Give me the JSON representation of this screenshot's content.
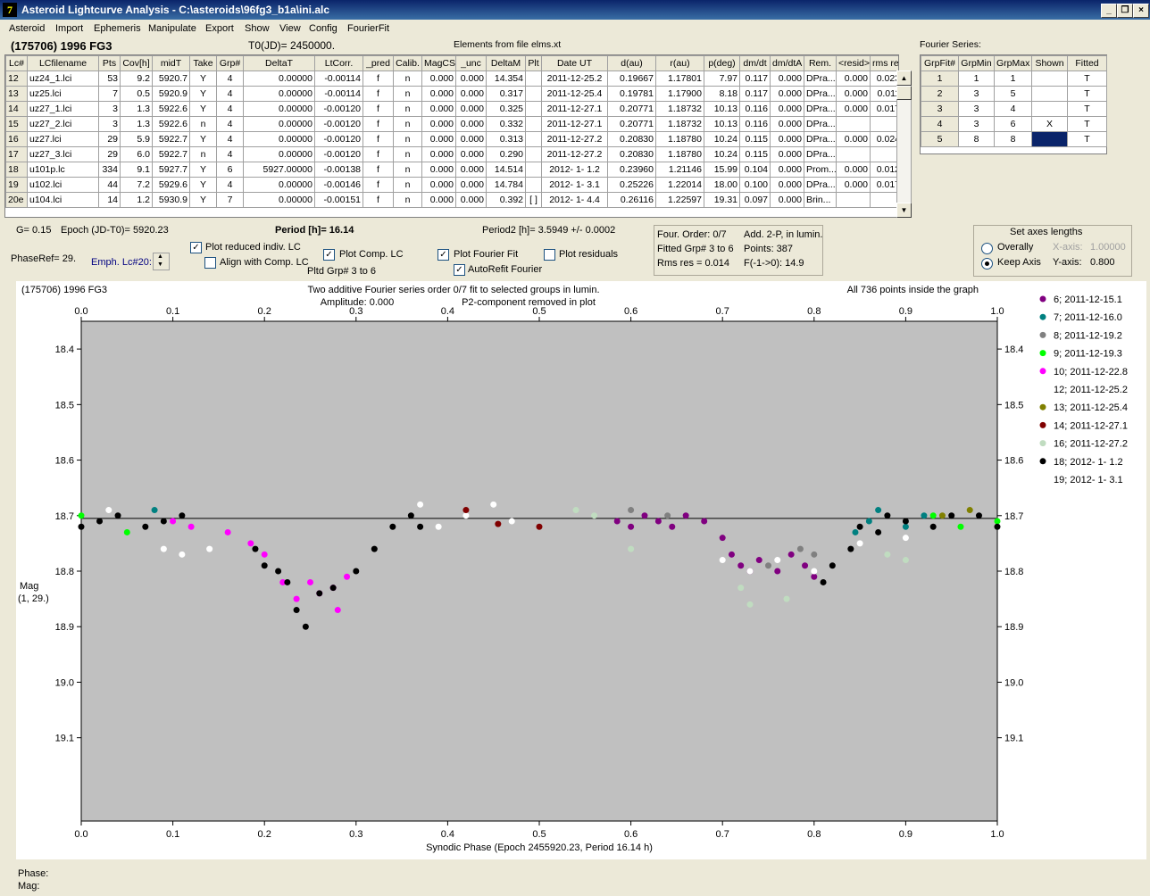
{
  "window": {
    "title": "Asteroid Lightcurve Analysis - C:\\asteroids\\96fg3_b1a\\ini.alc",
    "icon": "app-icon",
    "min": "_",
    "restore": "❐",
    "close": "×"
  },
  "menu": [
    "Asteroid",
    "Import",
    "Ephemeris",
    "Manipulate",
    "Export",
    "Show",
    "View",
    "Config",
    "FourierFit"
  ],
  "header": {
    "asteroid": "(175706) 1996 FG3",
    "t0": "T0(JD)= 2450000.",
    "elements": "Elements from file elms.xt",
    "fourier_series": "Fourier Series:"
  },
  "lc_table": {
    "columns": [
      "Lc#",
      "LCfilename",
      "Pts",
      "Cov[h]",
      "midT",
      "Take",
      "Grp#",
      "DeltaT",
      "LtCorr.",
      "_pred",
      "Calib.",
      "MagCS",
      "_unc",
      "DeltaM",
      "Plt",
      "Date UT",
      "d(au)",
      "r(au)",
      "p(deg)",
      "dm/dt",
      "dm/dtA",
      "Rem.",
      "<resid>",
      "rms res"
    ],
    "rows": [
      [
        "12",
        "uz24_1.lci",
        "53",
        "9.2",
        "5920.7",
        "Y",
        "4",
        "0.00000",
        "-0.00114",
        "f",
        "n",
        "0.000",
        "0.000",
        "14.354",
        "",
        "2011-12-25.2",
        "0.19667",
        "1.17801",
        "7.97",
        "0.117",
        "0.000",
        "DPra...",
        "0.000",
        "0.023"
      ],
      [
        "13",
        "uz25.lci",
        "7",
        "0.5",
        "5920.9",
        "Y",
        "4",
        "0.00000",
        "-0.00114",
        "f",
        "n",
        "0.000",
        "0.000",
        "0.317",
        "",
        "2011-12-25.4",
        "0.19781",
        "1.17900",
        "8.18",
        "0.117",
        "0.000",
        "DPra...",
        "0.000",
        "0.011"
      ],
      [
        "14",
        "uz27_1.lci",
        "3",
        "1.3",
        "5922.6",
        "Y",
        "4",
        "0.00000",
        "-0.00120",
        "f",
        "n",
        "0.000",
        "0.000",
        "0.325",
        "",
        "2011-12-27.1",
        "0.20771",
        "1.18732",
        "10.13",
        "0.116",
        "0.000",
        "DPra...",
        "0.000",
        "0.017"
      ],
      [
        "15",
        "uz27_2.lci",
        "3",
        "1.3",
        "5922.6",
        "n",
        "4",
        "0.00000",
        "-0.00120",
        "f",
        "n",
        "0.000",
        "0.000",
        "0.332",
        "",
        "2011-12-27.1",
        "0.20771",
        "1.18732",
        "10.13",
        "0.116",
        "0.000",
        "DPra...",
        "",
        ""
      ],
      [
        "16",
        "uz27.lci",
        "29",
        "5.9",
        "5922.7",
        "Y",
        "4",
        "0.00000",
        "-0.00120",
        "f",
        "n",
        "0.000",
        "0.000",
        "0.313",
        "",
        "2011-12-27.2",
        "0.20830",
        "1.18780",
        "10.24",
        "0.115",
        "0.000",
        "DPra...",
        "0.000",
        "0.024"
      ],
      [
        "17",
        "uz27_3.lci",
        "29",
        "6.0",
        "5922.7",
        "n",
        "4",
        "0.00000",
        "-0.00120",
        "f",
        "n",
        "0.000",
        "0.000",
        "0.290",
        "",
        "2011-12-27.2",
        "0.20830",
        "1.18780",
        "10.24",
        "0.115",
        "0.000",
        "DPra...",
        "",
        ""
      ],
      [
        "18",
        "u101p.lc",
        "334",
        "9.1",
        "5927.7",
        "Y",
        "6",
        "5927.00000",
        "-0.00138",
        "f",
        "n",
        "0.000",
        "0.000",
        "14.514",
        "",
        "2012- 1- 1.2",
        "0.23960",
        "1.21146",
        "15.99",
        "0.104",
        "0.000",
        "Prom...",
        "0.000",
        "0.012"
      ],
      [
        "19",
        "u102.lci",
        "44",
        "7.2",
        "5929.6",
        "Y",
        "4",
        "0.00000",
        "-0.00146",
        "f",
        "n",
        "0.000",
        "0.000",
        "14.784",
        "",
        "2012- 1- 3.1",
        "0.25226",
        "1.22014",
        "18.00",
        "0.100",
        "0.000",
        "DPra...",
        "0.000",
        "0.017"
      ],
      [
        "20e",
        "u104.lci",
        "14",
        "1.2",
        "5930.9",
        "Y",
        "7",
        "0.00000",
        "-0.00151",
        "f",
        "n",
        "0.000",
        "0.000",
        "0.392",
        "[ ]",
        "2012- 1- 4.4",
        "0.26116",
        "1.22597",
        "19.31",
        "0.097",
        "0.000",
        "Brin...",
        "",
        ""
      ]
    ]
  },
  "fourier_table": {
    "columns": [
      "GrpFit#",
      "GrpMin",
      "GrpMax",
      "Shown",
      "Fitted"
    ],
    "rows": [
      [
        "1",
        "1",
        "1",
        "",
        "T"
      ],
      [
        "2",
        "3",
        "5",
        "",
        "T"
      ],
      [
        "3",
        "3",
        "4",
        "",
        "T"
      ],
      [
        "4",
        "3",
        "6",
        "X",
        "T"
      ],
      [
        "5",
        "8",
        "8",
        "",
        "T"
      ]
    ]
  },
  "params": {
    "g": "G= 0.15",
    "epoch": "Epoch (JD-T0)= 5920.23",
    "period": "Period [h]= 16.14",
    "period2": "Period2 [h]= 3.5949 +/- 0.0002",
    "phase_ref": "PhaseRef= 29.",
    "emph": "Emph. Lc#20:",
    "pltd_grp": "Pltd Grp#  3  to   6"
  },
  "checkboxes": {
    "plot_reduced": "Plot reduced indiv. LC",
    "align": "Align with Comp. LC",
    "plot_comp": "Plot Comp. LC",
    "plot_fourier": "Plot Fourier Fit",
    "autorefit": "AutoRefit Fourier",
    "plot_residuals": "Plot residuals"
  },
  "fit_info": {
    "order": "Four. Order:  0/7",
    "add": "Add. 2-P, in lumin.",
    "fitted": "Fitted Grp# 3 to 6",
    "points": "Points: 387",
    "rms": "Rms res     = 0.014",
    "f": "F(-1->0):  14.9"
  },
  "axes_box": {
    "title": "Set axes lengths",
    "overally": "Overally",
    "keep": "Keep Axis",
    "xaxis_label": "X-axis:",
    "xaxis_val": "1.00000",
    "yaxis_label": "Y-axis:",
    "yaxis_val": "0.800"
  },
  "plot": {
    "asteroid": "(175706) 1996 FG3",
    "title1": "Two additive Fourier series order 0/7 fit to selected groups in lumin.",
    "title2": "Amplitude: 0.000",
    "title3": "P2-component removed in plot",
    "inside": "All 736 points inside the graph",
    "ylabel1": "Mag",
    "ylabel2": "(1, 29.)",
    "xlabel": "Synodic Phase (Epoch 2455920.23, Period 16.14 h)",
    "legend": [
      {
        "label": "6; 2011-12-15.1",
        "color": "#800080"
      },
      {
        "label": "7; 2011-12-16.0",
        "color": "#008080"
      },
      {
        "label": "8; 2011-12-19.2",
        "color": "#808080"
      },
      {
        "label": "9; 2011-12-19.3",
        "color": "#00ff00"
      },
      {
        "label": "10; 2011-12-22.8",
        "color": "#ff00ff"
      },
      {
        "label": "12; 2011-12-25.2",
        "color": "#ffffff"
      },
      {
        "label": "13; 2011-12-25.4",
        "color": "#808000"
      },
      {
        "label": "14; 2011-12-27.1",
        "color": "#800000"
      },
      {
        "label": "16; 2011-12-27.2",
        "color": "#c0dcc0"
      },
      {
        "label": "18; 2012- 1- 1.2",
        "color": "#000000"
      },
      {
        "label": "19; 2012- 1- 3.1",
        "color": "#ffffff"
      }
    ]
  },
  "chart_data": {
    "type": "scatter",
    "xlabel": "Synodic Phase (Epoch 2455920.23, Period 16.14 h)",
    "ylabel": "Mag",
    "xlim": [
      0.0,
      1.0
    ],
    "ylim": [
      19.25,
      18.35
    ],
    "xticks": [
      "0.0",
      "0.1",
      "0.2",
      "0.3",
      "0.4",
      "0.5",
      "0.6",
      "0.7",
      "0.8",
      "0.9",
      "1.0"
    ],
    "yticks": [
      "18.4",
      "18.5",
      "18.6",
      "18.7",
      "18.8",
      "18.9",
      "19.0",
      "19.1"
    ],
    "reference_line": 18.705,
    "series": [
      {
        "name": "6; 2011-12-15.1",
        "color": "#800080",
        "points": [
          [
            0.585,
            18.71
          ],
          [
            0.6,
            18.72
          ],
          [
            0.615,
            18.7
          ],
          [
            0.63,
            18.71
          ],
          [
            0.645,
            18.72
          ],
          [
            0.66,
            18.7
          ],
          [
            0.68,
            18.71
          ],
          [
            0.7,
            18.74
          ],
          [
            0.71,
            18.77
          ],
          [
            0.72,
            18.79
          ],
          [
            0.73,
            18.8
          ],
          [
            0.74,
            18.78
          ],
          [
            0.76,
            18.8
          ],
          [
            0.775,
            18.77
          ],
          [
            0.79,
            18.79
          ],
          [
            0.8,
            18.81
          ]
        ]
      },
      {
        "name": "7; 2011-12-16.0",
        "color": "#008080",
        "points": [
          [
            0.08,
            18.69
          ],
          [
            0.845,
            18.73
          ],
          [
            0.86,
            18.71
          ],
          [
            0.87,
            18.69
          ],
          [
            0.9,
            18.72
          ],
          [
            0.92,
            18.7
          ]
        ]
      },
      {
        "name": "8; 2011-12-19.2",
        "color": "#808080",
        "points": [
          [
            0.6,
            18.69
          ],
          [
            0.64,
            18.7
          ],
          [
            0.75,
            18.79
          ],
          [
            0.785,
            18.76
          ],
          [
            0.8,
            18.77
          ]
        ]
      },
      {
        "name": "9; 2011-12-19.3",
        "color": "#00ff00",
        "points": [
          [
            0.0,
            18.7
          ],
          [
            0.05,
            18.73
          ],
          [
            0.93,
            18.7
          ],
          [
            0.96,
            18.72
          ],
          [
            1.0,
            18.71
          ]
        ]
      },
      {
        "name": "10; 2011-12-22.8",
        "color": "#ff00ff",
        "points": [
          [
            0.1,
            18.71
          ],
          [
            0.12,
            18.72
          ],
          [
            0.16,
            18.73
          ],
          [
            0.185,
            18.75
          ],
          [
            0.2,
            18.77
          ],
          [
            0.22,
            18.82
          ],
          [
            0.235,
            18.85
          ],
          [
            0.25,
            18.82
          ],
          [
            0.26,
            18.84
          ],
          [
            0.275,
            18.83
          ],
          [
            0.28,
            18.87
          ],
          [
            0.29,
            18.81
          ]
        ]
      },
      {
        "name": "12; 2011-12-25.2",
        "color": "#ffffff",
        "points": [
          [
            0.03,
            18.69
          ],
          [
            0.09,
            18.76
          ],
          [
            0.11,
            18.77
          ],
          [
            0.14,
            18.76
          ],
          [
            0.37,
            18.68
          ],
          [
            0.39,
            18.72
          ],
          [
            0.42,
            18.7
          ],
          [
            0.45,
            18.68
          ],
          [
            0.47,
            18.71
          ]
        ]
      },
      {
        "name": "13; 2011-12-25.4",
        "color": "#808000",
        "points": [
          [
            0.94,
            18.7
          ],
          [
            0.97,
            18.69
          ]
        ]
      },
      {
        "name": "14; 2011-12-27.1",
        "color": "#800000",
        "points": [
          [
            0.42,
            18.69
          ],
          [
            0.455,
            18.715
          ],
          [
            0.5,
            18.72
          ]
        ]
      },
      {
        "name": "16; 2011-12-27.2",
        "color": "#c0dcc0",
        "points": [
          [
            0.54,
            18.69
          ],
          [
            0.56,
            18.7
          ],
          [
            0.6,
            18.76
          ],
          [
            0.72,
            18.83
          ],
          [
            0.73,
            18.86
          ],
          [
            0.77,
            18.85
          ],
          [
            0.88,
            18.77
          ],
          [
            0.9,
            18.78
          ]
        ]
      },
      {
        "name": "18; 2012- 1- 1.2",
        "color": "#000000",
        "points": [
          [
            0.0,
            18.72
          ],
          [
            0.02,
            18.71
          ],
          [
            0.04,
            18.7
          ],
          [
            0.07,
            18.72
          ],
          [
            0.09,
            18.71
          ],
          [
            0.11,
            18.7
          ],
          [
            0.19,
            18.76
          ],
          [
            0.2,
            18.79
          ],
          [
            0.215,
            18.8
          ],
          [
            0.225,
            18.82
          ],
          [
            0.235,
            18.87
          ],
          [
            0.245,
            18.9
          ],
          [
            0.26,
            18.84
          ],
          [
            0.275,
            18.83
          ],
          [
            0.3,
            18.8
          ],
          [
            0.32,
            18.76
          ],
          [
            0.34,
            18.72
          ],
          [
            0.36,
            18.7
          ],
          [
            0.37,
            18.72
          ],
          [
            0.81,
            18.82
          ],
          [
            0.82,
            18.79
          ],
          [
            0.84,
            18.76
          ],
          [
            0.85,
            18.72
          ],
          [
            0.87,
            18.73
          ],
          [
            0.88,
            18.7
          ],
          [
            0.9,
            18.71
          ],
          [
            0.93,
            18.72
          ],
          [
            0.95,
            18.7
          ],
          [
            0.98,
            18.7
          ],
          [
            1.0,
            18.72
          ]
        ]
      },
      {
        "name": "19; 2012- 1- 3.1",
        "color": "#ffffff",
        "points": [
          [
            0.7,
            18.78
          ],
          [
            0.73,
            18.8
          ],
          [
            0.76,
            18.78
          ],
          [
            0.8,
            18.8
          ],
          [
            0.85,
            18.75
          ],
          [
            0.9,
            18.74
          ]
        ]
      }
    ]
  }
}
